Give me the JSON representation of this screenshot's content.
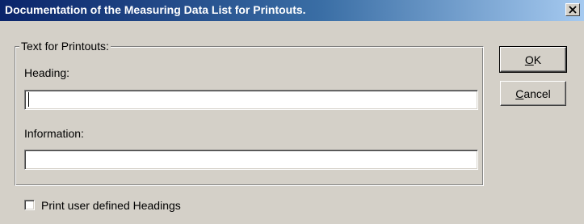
{
  "window": {
    "title": "Documentation of the Measuring Data List for Printouts.",
    "close_icon": "close-icon"
  },
  "group": {
    "label": "Text for Printouts:"
  },
  "heading": {
    "label": "Heading:",
    "value": ""
  },
  "information": {
    "label": "Information:",
    "value": ""
  },
  "buttons": {
    "ok": {
      "mnemonic": "O",
      "rest": "K"
    },
    "cancel": {
      "mnemonic": "C",
      "rest": "ancel"
    }
  },
  "checkbox": {
    "label": "Print user defined Headings",
    "checked": false
  },
  "colors": {
    "titlebar_start": "#0a246a",
    "titlebar_end": "#a6caf0",
    "face": "#d4d0c8"
  }
}
